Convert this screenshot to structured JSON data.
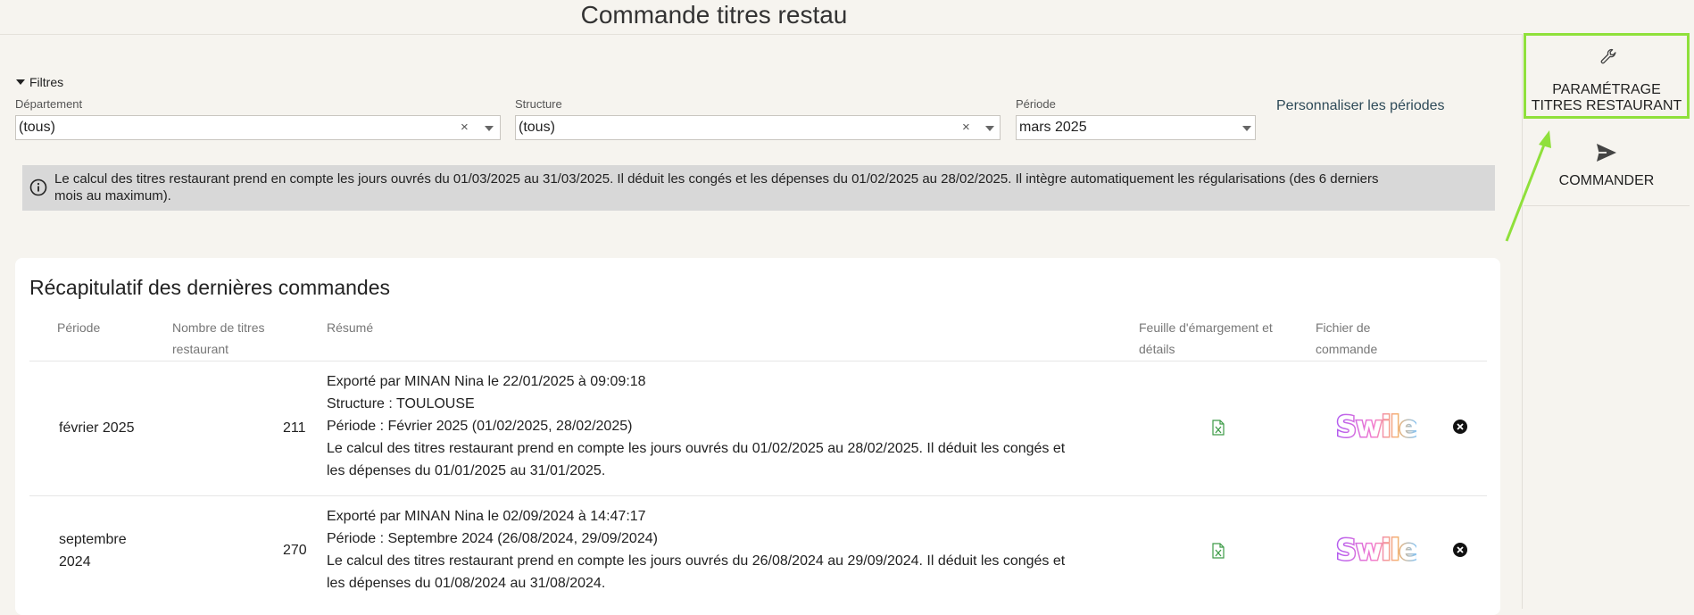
{
  "header": {
    "title": "Commande titres restau"
  },
  "side_actions": {
    "param_label_1": "PARAMÉTRAGE",
    "param_label_2": "TITRES RESTAURANT",
    "commander_label": "COMMANDER"
  },
  "filters": {
    "toggle_label": "Filtres",
    "departement": {
      "label": "Département",
      "value": "(tous)"
    },
    "structure": {
      "label": "Structure",
      "value": "(tous)"
    },
    "periode": {
      "label": "Période",
      "value": "mars 2025"
    },
    "custom_periods_link": "Personnaliser les périodes"
  },
  "info": {
    "line1": "Le calcul des titres restaurant prend en compte les jours ouvrés du 01/03/2025 au 31/03/2025. Il déduit les congés et les dépenses du 01/02/2025 au 28/02/2025. Il intègre automatiquement les régularisations (des 6 derniers",
    "line2": "mois au maximum)."
  },
  "summary": {
    "title": "Récapitulatif des dernières commandes",
    "columns": {
      "periode": "Période",
      "nombre_1": "Nombre de titres",
      "nombre_2": "restaurant",
      "resume": "Résumé",
      "feuille_1": "Feuille d'émargement et",
      "feuille_2": "détails",
      "fichier_1": "Fichier de",
      "fichier_2": "commande"
    },
    "rows": [
      {
        "periode": "février 2025",
        "nombre": "211",
        "resume": [
          "Exporté par MINAN Nina le 22/01/2025 à 09:09:18",
          "Structure : TOULOUSE",
          "Période : Février 2025 (01/02/2025, 28/02/2025)",
          "Le calcul des titres restaurant prend en compte les jours ouvrés du 01/02/2025 au 28/02/2025. Il déduit les congés et",
          "les dépenses du 01/01/2025 au 31/01/2025."
        ],
        "fichier": "Swile"
      },
      {
        "periode_1": "septembre",
        "periode_2": "2024",
        "nombre": "270",
        "resume": [
          "Exporté par MINAN Nina le 02/09/2024 à 14:47:17",
          "Période : Septembre 2024 (26/08/2024, 29/09/2024)",
          "Le calcul des titres restaurant prend en compte les jours ouvrés du 26/08/2024 au 29/09/2024. Il déduit les congés et",
          "les dépenses du 01/08/2024 au 31/08/2024."
        ],
        "fichier": "Swile"
      }
    ]
  },
  "colors": {
    "highlight": "#8fe03b",
    "excel_green": "#3d9b47",
    "background": "#f6f4ef"
  }
}
